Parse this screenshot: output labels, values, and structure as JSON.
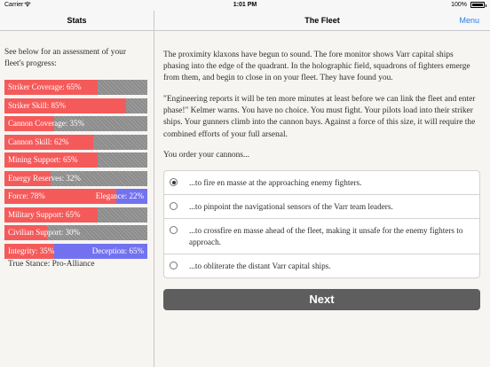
{
  "status_bar": {
    "carrier": "Carrier",
    "time": "1:01 PM",
    "battery": "100%"
  },
  "left_nav": {
    "title": "Stats"
  },
  "right_nav": {
    "title": "The Fleet",
    "menu_label": "Menu"
  },
  "stats": {
    "intro": "See below for an assessment of your fleet's progress:",
    "bars": [
      {
        "label": "Striker Coverage: 65%",
        "value": 0.65
      },
      {
        "label": "Striker Skill: 85%",
        "value": 0.85
      },
      {
        "label": "Cannon Coverage: 35%",
        "value": 0.35
      },
      {
        "label": "Cannon Skill: 62%",
        "value": 0.62
      },
      {
        "label": "Mining Support: 65%",
        "value": 0.65
      },
      {
        "label": "Energy Reserves: 32%",
        "value": 0.32
      },
      {
        "label": "Force: 78%",
        "value": 0.78,
        "right_label": "Elegance: 22%",
        "right_value": 0.22
      },
      {
        "label": "Military Support: 65%",
        "value": 0.65
      },
      {
        "label": "Civilian Support: 30%",
        "value": 0.3
      },
      {
        "label": "Integrity: 35%",
        "value": 0.35,
        "right_label": "Deception: 65%",
        "right_value": 0.65
      }
    ],
    "stance": "True Stance: Pro-Alliance"
  },
  "story": {
    "p1": "The proximity klaxons have begun to sound. The fore monitor shows Varr capital ships phasing into the edge of the quadrant. In the holographic field, squadrons of fighters emerge from them, and begin to close in on your fleet. They have found you.",
    "p2": "\"Engineering reports it will be ten more minutes at least before we can link the fleet and enter phase!\" Kelmer warns. You have no choice. You must fight. Your pilots load into their striker ships. Your gunners climb into the cannon bays. Against a force of this size, it will require the combined efforts of your full arsenal.",
    "prompt": "You order your cannons..."
  },
  "choices": [
    {
      "label": "...to fire en masse at the approaching enemy fighters.",
      "selected": true
    },
    {
      "label": "...to pinpoint the navigational sensors of the Varr team leaders.",
      "selected": false
    },
    {
      "label": "...to crossfire en masse ahead of the fleet, making it unsafe for the enemy fighters to approach.",
      "selected": false
    },
    {
      "label": "...to obliterate the distant Varr capital ships.",
      "selected": false
    }
  ],
  "next_label": "Next",
  "colors": {
    "bar_fill": "#f55a5a",
    "bar_alt": "#7272f0",
    "bar_track": "#8c8c8c",
    "accent": "#2b7de9",
    "button": "#5e5e5e"
  }
}
